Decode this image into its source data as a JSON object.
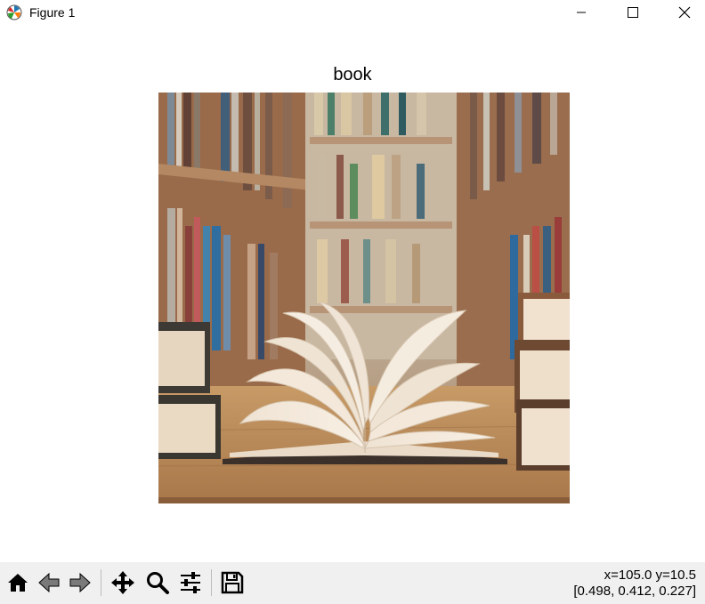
{
  "window": {
    "title": "Figure 1"
  },
  "figure": {
    "title": "book",
    "image_subject": "open book on wooden table in front of library bookshelves"
  },
  "toolbar": {
    "buttons": [
      "home",
      "back",
      "forward",
      "pan",
      "zoom",
      "configure-subplots",
      "save"
    ],
    "coords_line1": "x=105.0 y=10.5",
    "coords_line2": "[0.498, 0.412, 0.227]"
  },
  "colors": {
    "toolbar_bg": "#f0f0f0",
    "wood": "#b98a5a",
    "page": "#f1e6d6"
  }
}
